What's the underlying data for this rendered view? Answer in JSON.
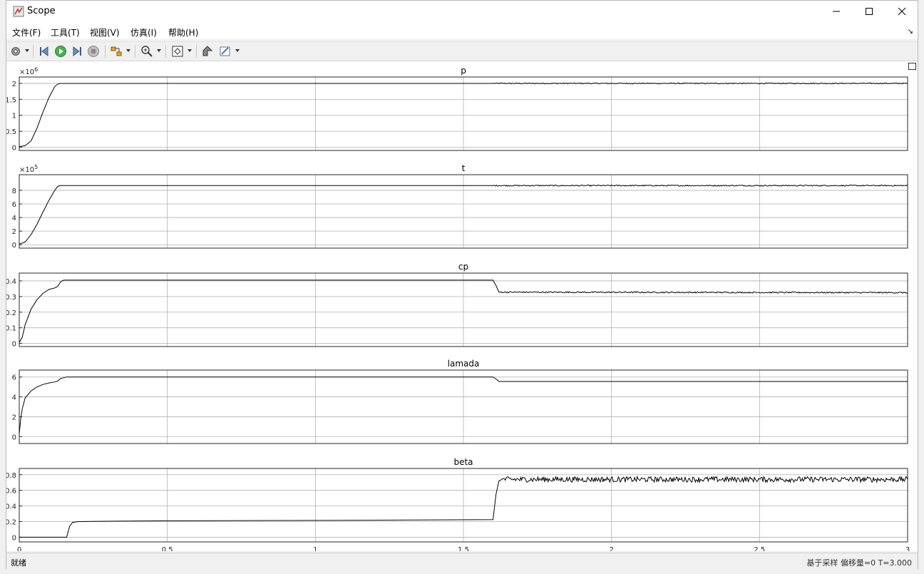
{
  "window": {
    "title": "Scope"
  },
  "menu": [
    {
      "label": "文件(F)"
    },
    {
      "label": "工具(T)"
    },
    {
      "label": "视图(V)"
    },
    {
      "label": "仿真(I)"
    },
    {
      "label": "帮助(H)"
    }
  ],
  "toolbar": {
    "icons": [
      "gear-icon",
      "step-back-icon",
      "run-icon",
      "step-forward-icon",
      "stop-icon",
      "signal-selector-icon",
      "zoom-icon",
      "autoscale-icon",
      "highlight-icon",
      "style-icon"
    ]
  },
  "status": {
    "left": "就绪",
    "right": "基于采样 偏移量=0 T=3.000"
  },
  "chart_data": [
    {
      "type": "line",
      "title": "p",
      "ylim": [
        -0.1,
        2.2
      ],
      "yticks": [
        0,
        0.5,
        1,
        1.5,
        2
      ],
      "ytick_labels": [
        "0",
        "0.5",
        "1",
        "1.5",
        "2"
      ],
      "exponent_base": "×10",
      "exponent_power": "6",
      "xlim": [
        0,
        3
      ],
      "grid": true,
      "series": [
        {
          "x": [
            0,
            0.02,
            0.04,
            0.06,
            0.08,
            0.1,
            0.12,
            0.13,
            0.14,
            0.15,
            1.6,
            3.0
          ],
          "y": [
            0.02,
            0.05,
            0.2,
            0.6,
            1.1,
            1.55,
            1.9,
            1.98,
            2.0,
            2.0,
            2.0,
            2.0
          ],
          "noise_from": 1.6,
          "noise": 0.015
        }
      ]
    },
    {
      "type": "line",
      "title": "t",
      "ylim": [
        -0.5,
        10.3
      ],
      "yticks": [
        0,
        2,
        4,
        6,
        8
      ],
      "ytick_labels": [
        "0",
        "2",
        "4",
        "6",
        "8"
      ],
      "exponent_base": "×10",
      "exponent_power": "5",
      "xlim": [
        0,
        3
      ],
      "grid": true,
      "series": [
        {
          "x": [
            0,
            0.02,
            0.04,
            0.06,
            0.08,
            0.1,
            0.12,
            0.13,
            0.14,
            0.15,
            1.6,
            3.0
          ],
          "y": [
            0.1,
            0.4,
            1.5,
            3.0,
            4.8,
            6.5,
            8.0,
            8.6,
            8.7,
            8.7,
            8.7,
            8.7
          ],
          "noise_from": 1.6,
          "noise": 0.08
        }
      ]
    },
    {
      "type": "line",
      "title": "cp",
      "ylim": [
        -0.02,
        0.45
      ],
      "yticks": [
        0,
        0.1,
        0.2,
        0.3,
        0.4
      ],
      "ytick_labels": [
        "0",
        "0.1",
        "0.2",
        "0.3",
        "0.4"
      ],
      "xlim": [
        0,
        3
      ],
      "grid": true,
      "series": [
        {
          "x": [
            0,
            0.01,
            0.02,
            0.04,
            0.06,
            0.08,
            0.1,
            0.12,
            0.13,
            0.14,
            0.15,
            0.5,
            1.6,
            1.61,
            1.62,
            3.0
          ],
          "y": [
            0.005,
            0.04,
            0.12,
            0.22,
            0.28,
            0.32,
            0.345,
            0.355,
            0.365,
            0.395,
            0.405,
            0.405,
            0.405,
            0.37,
            0.328,
            0.325
          ],
          "noise_from": 1.62,
          "noise": 0.004
        }
      ]
    },
    {
      "type": "line",
      "title": "lamada",
      "ylim": [
        -0.7,
        6.7
      ],
      "yticks": [
        0,
        2,
        4,
        6
      ],
      "ytick_labels": [
        "0",
        "2",
        "4",
        "6"
      ],
      "xlim": [
        0,
        3
      ],
      "grid": true,
      "series": [
        {
          "x": [
            0,
            0.005,
            0.01,
            0.02,
            0.04,
            0.06,
            0.08,
            0.1,
            0.12,
            0.13,
            0.14,
            0.16,
            1.6,
            1.61,
            1.62,
            3.0
          ],
          "y": [
            0.3,
            1.8,
            2.8,
            3.9,
            4.6,
            5.0,
            5.25,
            5.4,
            5.5,
            5.6,
            5.85,
            6.0,
            6.0,
            5.8,
            5.55,
            5.55
          ],
          "noise_from": 9,
          "noise": 0
        }
      ]
    },
    {
      "type": "line",
      "title": "beta",
      "ylim": [
        -0.06,
        0.88
      ],
      "yticks": [
        0,
        0.2,
        0.4,
        0.6,
        0.8
      ],
      "ytick_labels": [
        "0",
        "0.2",
        "0.4",
        "0.6",
        "0.8"
      ],
      "xticks": [
        0,
        0.5,
        1,
        1.5,
        2,
        2.5,
        3
      ],
      "xtick_labels": [
        "0",
        "0.5",
        "1",
        "1.5",
        "2",
        "2.5",
        "3"
      ],
      "xlim": [
        0,
        3
      ],
      "grid": true,
      "series": [
        {
          "x": [
            0,
            0.16,
            0.17,
            0.18,
            0.2,
            0.3,
            0.5,
            1.0,
            1.6,
            1.61,
            1.62,
            1.63,
            3.0
          ],
          "y": [
            0,
            0,
            0.14,
            0.19,
            0.2,
            0.205,
            0.21,
            0.215,
            0.225,
            0.55,
            0.72,
            0.74,
            0.74
          ],
          "noise_from": 1.63,
          "noise": 0.035
        }
      ]
    }
  ]
}
